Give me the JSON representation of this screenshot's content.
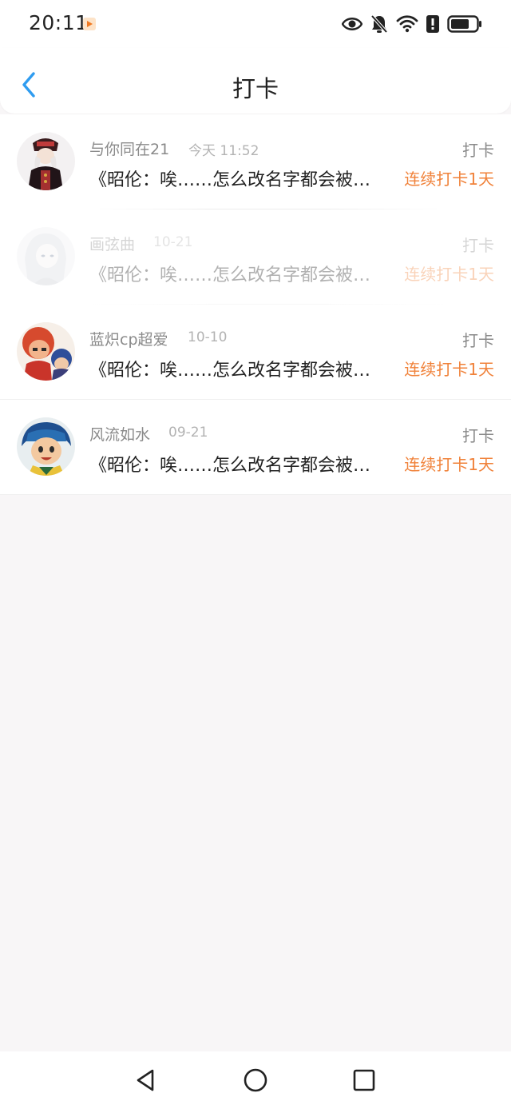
{
  "status": {
    "time": "20:11",
    "icons": [
      "video-app-indicator-icon",
      "eye-icon",
      "mute-icon",
      "wifi-icon",
      "alert-icon",
      "battery-icon"
    ]
  },
  "header": {
    "title": "打卡",
    "back_icon": "chevron-left-icon"
  },
  "list": {
    "items": [
      {
        "name": "与你同在21",
        "date": "今天 11:52",
        "tag": "打卡",
        "content": "《昭伦：唉……怎么改名字都会被…",
        "streak": "连续打卡1天"
      },
      {
        "name": "画弦曲",
        "date": "10-21",
        "tag": "打卡",
        "content": "《昭伦：唉……怎么改名字都会被…",
        "streak": "连续打卡1天"
      },
      {
        "name": "蓝炽cp超爱",
        "date": "10-10",
        "tag": "打卡",
        "content": "《昭伦：唉……怎么改名字都会被…",
        "streak": "连续打卡1天"
      },
      {
        "name": "风流如水",
        "date": "09-21",
        "tag": "打卡",
        "content": "《昭伦：唉……怎么改名字都会被…",
        "streak": "连续打卡1天"
      }
    ]
  },
  "nav": {
    "icons": [
      "back-triangle-icon",
      "home-circle-icon",
      "recents-square-icon"
    ]
  },
  "colors": {
    "accent": "#2f9cf0",
    "streak": "#f0823a",
    "background": "#f8f6f7"
  }
}
